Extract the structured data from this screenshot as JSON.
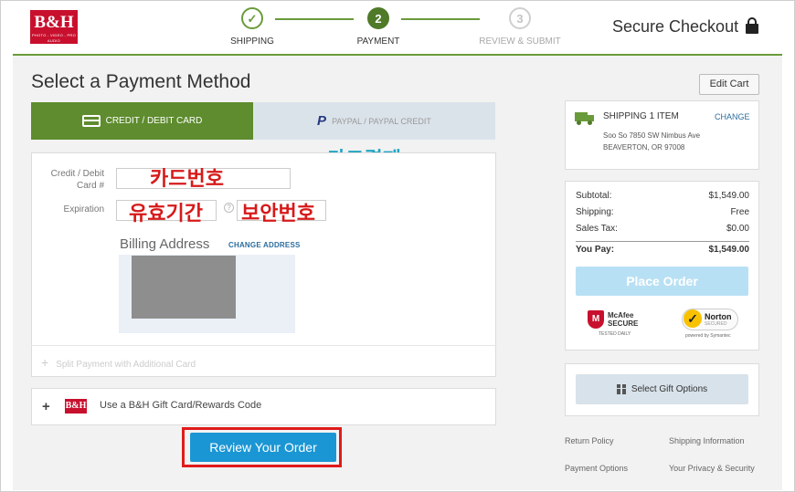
{
  "header": {
    "logo_text": "B&H",
    "logo_tagline": "PHOTO - VIDEO - PRO AUDIO",
    "steps": [
      {
        "number": "✓",
        "label": "SHIPPING"
      },
      {
        "number": "2",
        "label": "PAYMENT"
      },
      {
        "number": "3",
        "label": "REVIEW & SUBMIT"
      }
    ],
    "secure_checkout": "Secure Checkout"
  },
  "main": {
    "title": "Select a Payment Method",
    "edit_cart": "Edit Cart",
    "tabs": [
      {
        "label": "CREDIT / DEBIT CARD",
        "active": true
      },
      {
        "label": "PAYPAL / PAYPAL CREDIT",
        "active": false
      }
    ],
    "annotations": {
      "card_payment": "카드결제",
      "card_number": "카드번호",
      "expiration": "유효기간",
      "security_code": "보안번호"
    },
    "form": {
      "card_label": "Credit / Debit Card #",
      "expiration_label": "Expiration",
      "billing_title": "Billing Address",
      "change_address": "CHANGE ADDRESS",
      "split_payment": "Split Payment with Additional Card"
    },
    "gift_card": {
      "logo": "B&H",
      "label": "Use a B&H Gift Card/Rewards Code"
    },
    "review_button": "Review Your Order"
  },
  "sidebar": {
    "shipping": {
      "title": "SHIPPING 1 ITEM",
      "change": "CHANGE",
      "address_line1": "Soo So  7850 SW Nimbus Ave",
      "address_line2": "BEAVERTON, OR 97008"
    },
    "summary": {
      "subtotal_label": "Subtotal:",
      "subtotal": "$1,549.00",
      "shipping_label": "Shipping:",
      "shipping": "Free",
      "tax_label": "Sales Tax:",
      "tax": "$0.00",
      "you_pay_label": "You Pay:",
      "you_pay": "$1,549.00"
    },
    "place_order": "Place Order",
    "badges": {
      "mcafee_1": "McAfee",
      "mcafee_2": "SECURE",
      "mcafee_3": "TESTED DAILY",
      "norton_1": "Norton",
      "norton_2": "SECURED",
      "norton_3": "powered by Symantec"
    },
    "gift_options": "Select Gift Options"
  },
  "footer": {
    "return_policy": "Return Policy",
    "shipping_info": "Shipping Information",
    "payment_options": "Payment Options",
    "privacy": "Your Privacy & Security"
  },
  "colors": {
    "brand_red": "#c8102e",
    "green": "#5e8c2e",
    "blue_button": "#1b96d4",
    "annotation_red": "#d61a1a",
    "annotation_teal": "#23a5c4"
  }
}
